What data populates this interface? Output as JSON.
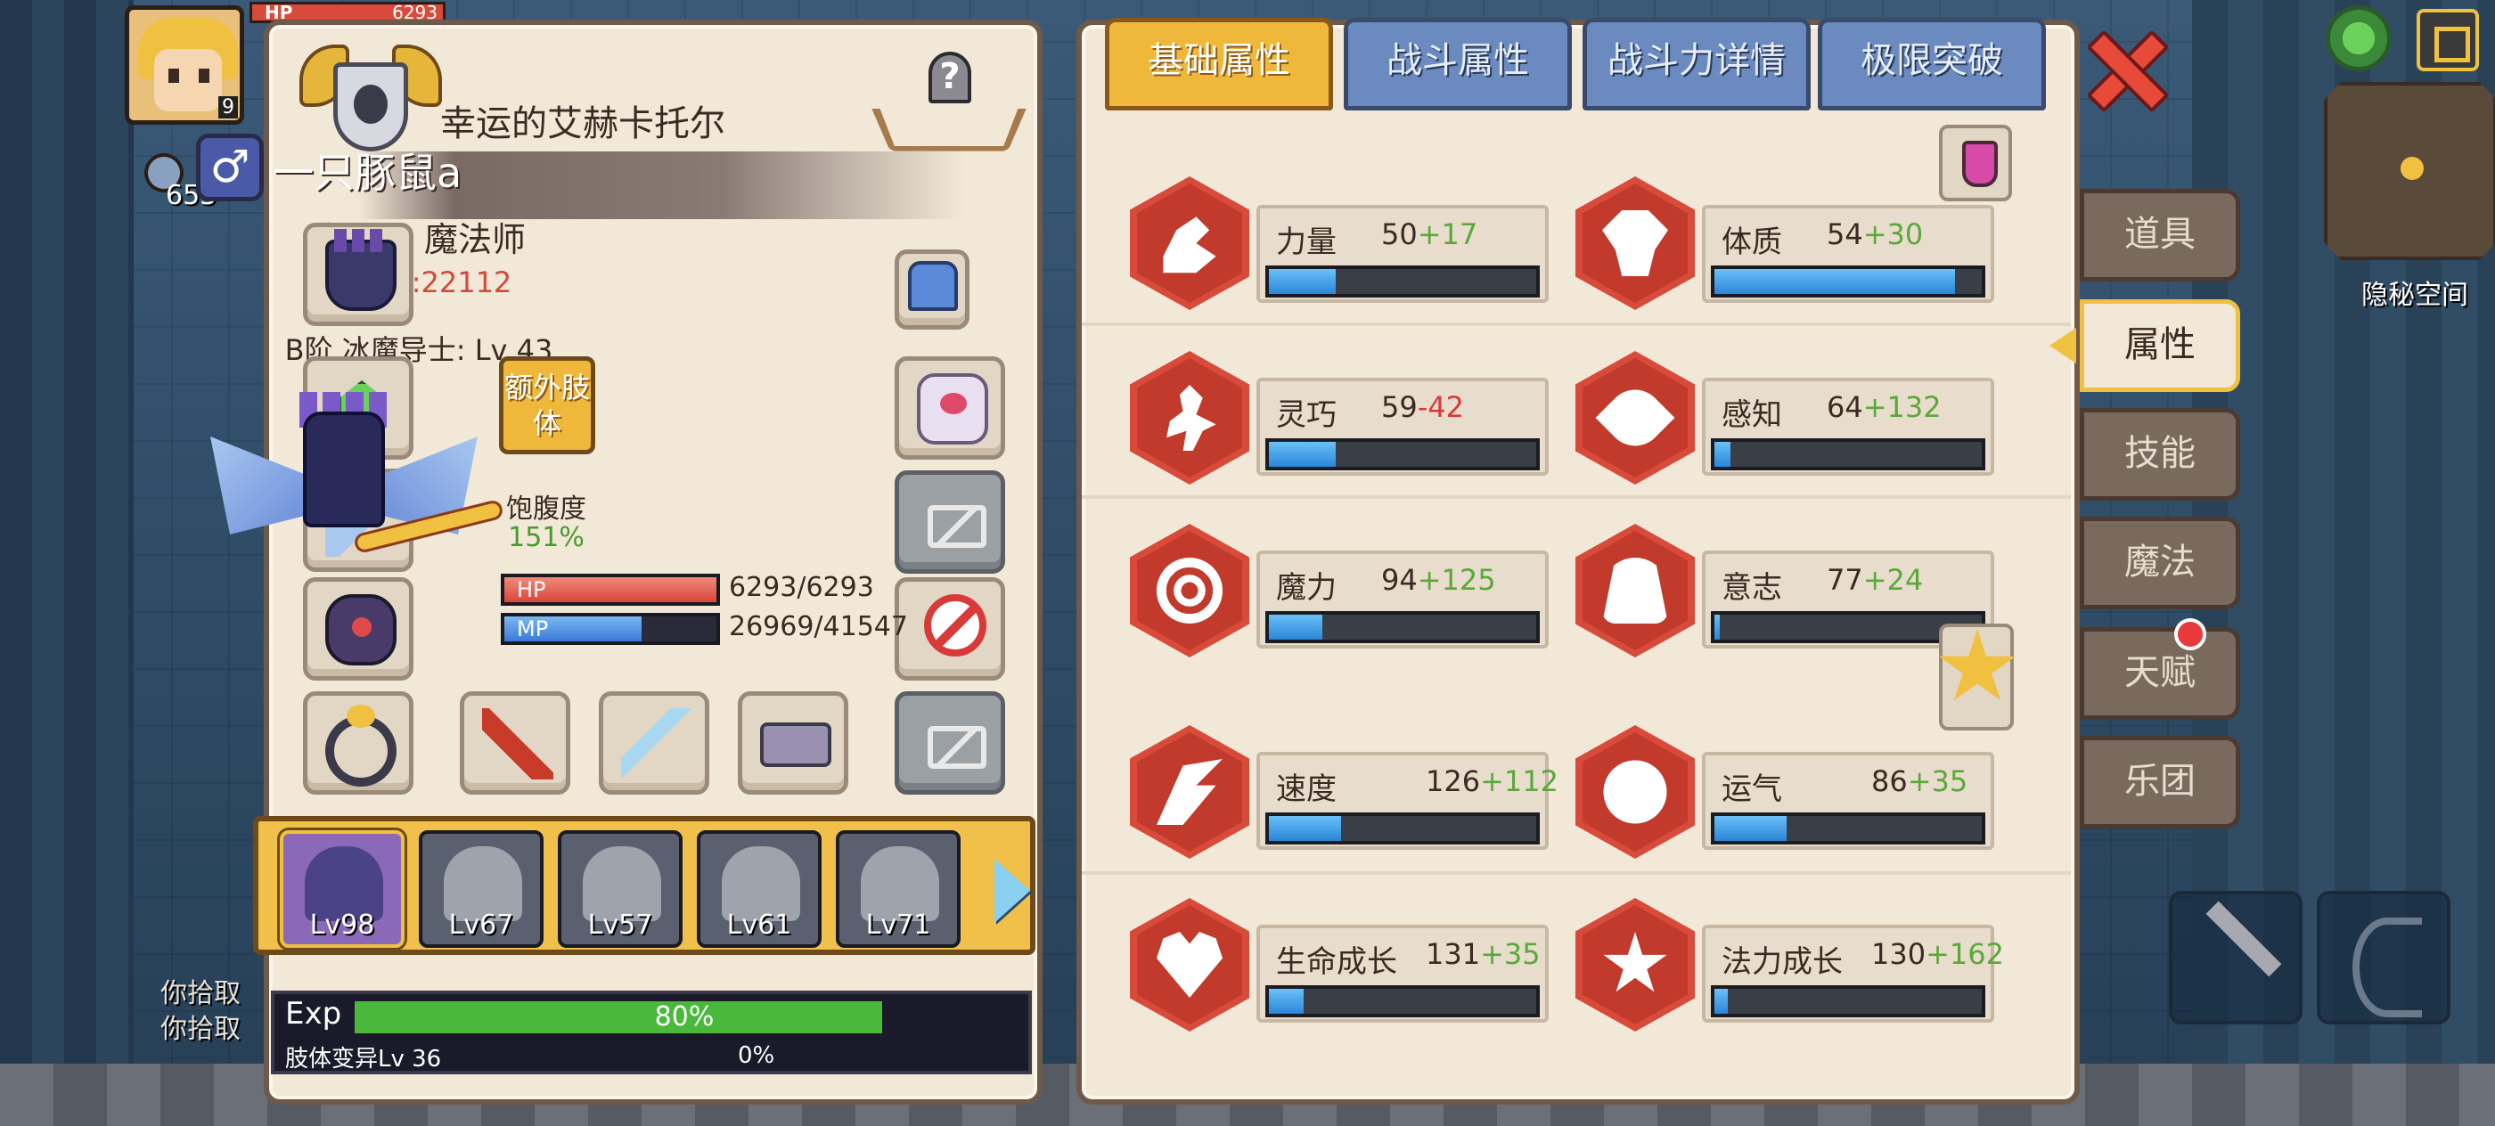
{
  "hud": {
    "hp_label": "HP",
    "hp_value": "6293",
    "avatar_level": "9",
    "gem_count": "653",
    "pickup_msg_1": "你拾取",
    "pickup_msg_2": "你拾取"
  },
  "character": {
    "title": "幸运的艾赫卡托尔",
    "gender_symbol": "♂",
    "name": "一只豚鼠a",
    "race_class": "变异人 魔法师",
    "combat_power": "战斗力:22112",
    "stage": "B阶 冰魔导士: Lv 43",
    "extra_limb_label": "额外肢体",
    "satiety_label": "饱腹度",
    "satiety_value": "151%",
    "hp_label": "HP",
    "hp_text": "6293/6293",
    "hp_fraction": 1.0,
    "mp_label": "MP",
    "mp_text": "26969/41547",
    "mp_fraction": 0.649,
    "hanger_symbol": "?"
  },
  "party": {
    "members": [
      {
        "level": "Lv98"
      },
      {
        "level": "Lv67"
      },
      {
        "level": "Lv57"
      },
      {
        "level": "Lv61"
      },
      {
        "level": "Lv71"
      }
    ]
  },
  "exp": {
    "label": "Exp",
    "percent": "80%",
    "fraction": 0.8,
    "limb_label": "肢体变异Lv 36",
    "limb_percent": "0%"
  },
  "tabs": [
    {
      "label": "基础属性",
      "active": true
    },
    {
      "label": "战斗属性",
      "active": false
    },
    {
      "label": "战斗力详情",
      "active": false
    },
    {
      "label": "极限突破",
      "active": false
    }
  ],
  "attributes": [
    {
      "name": "力量",
      "base": "50",
      "bonus": "+17",
      "bonus_sign": "plus",
      "fill": 0.25,
      "icon": "strength-icon"
    },
    {
      "name": "体质",
      "base": "54",
      "bonus": "+30",
      "bonus_sign": "plus",
      "fill": 0.9,
      "icon": "constitution-icon"
    },
    {
      "name": "灵巧",
      "base": "59",
      "bonus": "-42",
      "bonus_sign": "minus",
      "fill": 0.25,
      "icon": "agility-icon"
    },
    {
      "name": "感知",
      "base": "64",
      "bonus": "+132",
      "bonus_sign": "plus",
      "fill": 0.06,
      "icon": "perception-icon"
    },
    {
      "name": "魔力",
      "base": "94",
      "bonus": "+125",
      "bonus_sign": "plus",
      "fill": 0.2,
      "icon": "magic-icon"
    },
    {
      "name": "意志",
      "base": "77",
      "bonus": "+24",
      "bonus_sign": "plus",
      "fill": 0.02,
      "icon": "will-icon"
    },
    {
      "name": "速度",
      "base": "126",
      "bonus": "+112",
      "bonus_sign": "plus",
      "fill": 0.27,
      "icon": "speed-icon"
    },
    {
      "name": "运气",
      "base": "86",
      "bonus": "+35",
      "bonus_sign": "plus",
      "fill": 0.27,
      "icon": "luck-icon"
    },
    {
      "name": "生命成长",
      "base": "131",
      "bonus": "+35",
      "bonus_sign": "plus",
      "fill": 0.13,
      "icon": "life-growth-icon"
    },
    {
      "name": "法力成长",
      "base": "130",
      "bonus": "+162",
      "bonus_sign": "plus",
      "fill": 0.05,
      "icon": "mana-growth-icon"
    }
  ],
  "side_menu": [
    {
      "label": "道具",
      "active": false
    },
    {
      "label": "属性",
      "active": true
    },
    {
      "label": "技能",
      "active": false
    },
    {
      "label": "魔法",
      "active": false
    },
    {
      "label": "天赋",
      "active": false
    },
    {
      "label": "乐团",
      "active": false
    }
  ],
  "map": {
    "label": "隐秘空间"
  },
  "colors": {
    "panel_bg": "#f2e8d8",
    "tab_active": "#f0b83a",
    "tab_inactive": "#6a8ac0",
    "bonus_positive": "#5aa83a",
    "bonus_negative": "#d83a3a",
    "power_red": "#d24a3e",
    "bar_blue": "#2a86d8"
  }
}
